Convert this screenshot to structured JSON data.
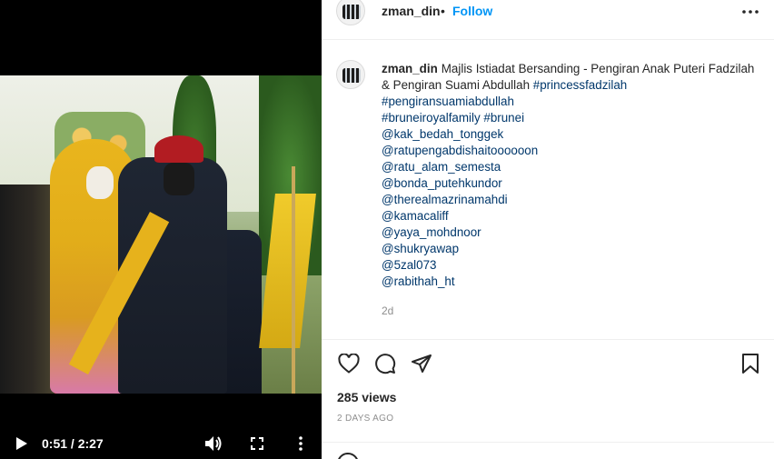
{
  "video": {
    "time_display": "0:51 / 2:27",
    "icons": {
      "play": "play-icon",
      "volume": "volume-icon",
      "fullscreen": "fullscreen-icon",
      "more": "more-vertical-icon"
    }
  },
  "header": {
    "username": "zman_din",
    "separator": "•",
    "follow_label": "Follow",
    "more_icon": "more-horizontal-icon"
  },
  "caption": {
    "username": "zman_din",
    "text": "Majlis Istiadat Bersanding - Pengiran Anak Puteri Fadzilah & Pengiran Suami Abdullah",
    "hashtag_inline": "#princessfadzilah",
    "lines": [
      "#pengiransuamiabdullah",
      "#bruneiroyalfamily #brunei",
      "@kak_bedah_tonggek",
      "@ratupengabdishaitoooooon",
      "@ratu_alam_semesta",
      "@bonda_putehkundor",
      "@therealmazrinamahdi",
      "@kamacaliff",
      "@yaya_mohdnoor",
      "@shukryawap",
      "@5zal073",
      "@rabithah_ht"
    ],
    "age": "2d"
  },
  "actions": {
    "icons": [
      "heart-icon",
      "comment-icon",
      "share-icon",
      "bookmark-icon"
    ]
  },
  "views": "285 views",
  "posted": "2 DAYS AGO",
  "colors": {
    "accent": "#0095f6",
    "link": "#00376b",
    "muted": "#8e8e8e"
  }
}
